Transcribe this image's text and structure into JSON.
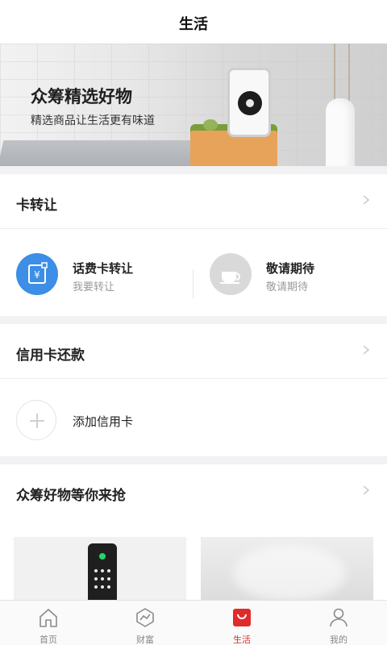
{
  "header": {
    "title": "生活"
  },
  "banner": {
    "title": "众筹精选好物",
    "subtitle": "精选商品让生活更有味道"
  },
  "card_transfer": {
    "title": "卡转让",
    "items": [
      {
        "title": "话费卡转让",
        "subtitle": "我要转让",
        "icon": "phone-card-icon",
        "color": "#3c8ee6"
      },
      {
        "title": "敬请期待",
        "subtitle": "敬请期待",
        "icon": "coffee-cup-icon",
        "color": "#d9d9d9"
      }
    ]
  },
  "credit_card": {
    "title": "信用卡还款",
    "add_label": "添加信用卡"
  },
  "crowdfund": {
    "title": "众筹好物等你来抢"
  },
  "tabbar": {
    "active_color": "#e02b2b",
    "tabs": [
      {
        "label": "首页",
        "icon": "home-icon"
      },
      {
        "label": "财富",
        "icon": "wealth-icon"
      },
      {
        "label": "生活",
        "icon": "life-bag-icon",
        "active": true
      },
      {
        "label": "我的",
        "icon": "user-icon"
      }
    ]
  }
}
